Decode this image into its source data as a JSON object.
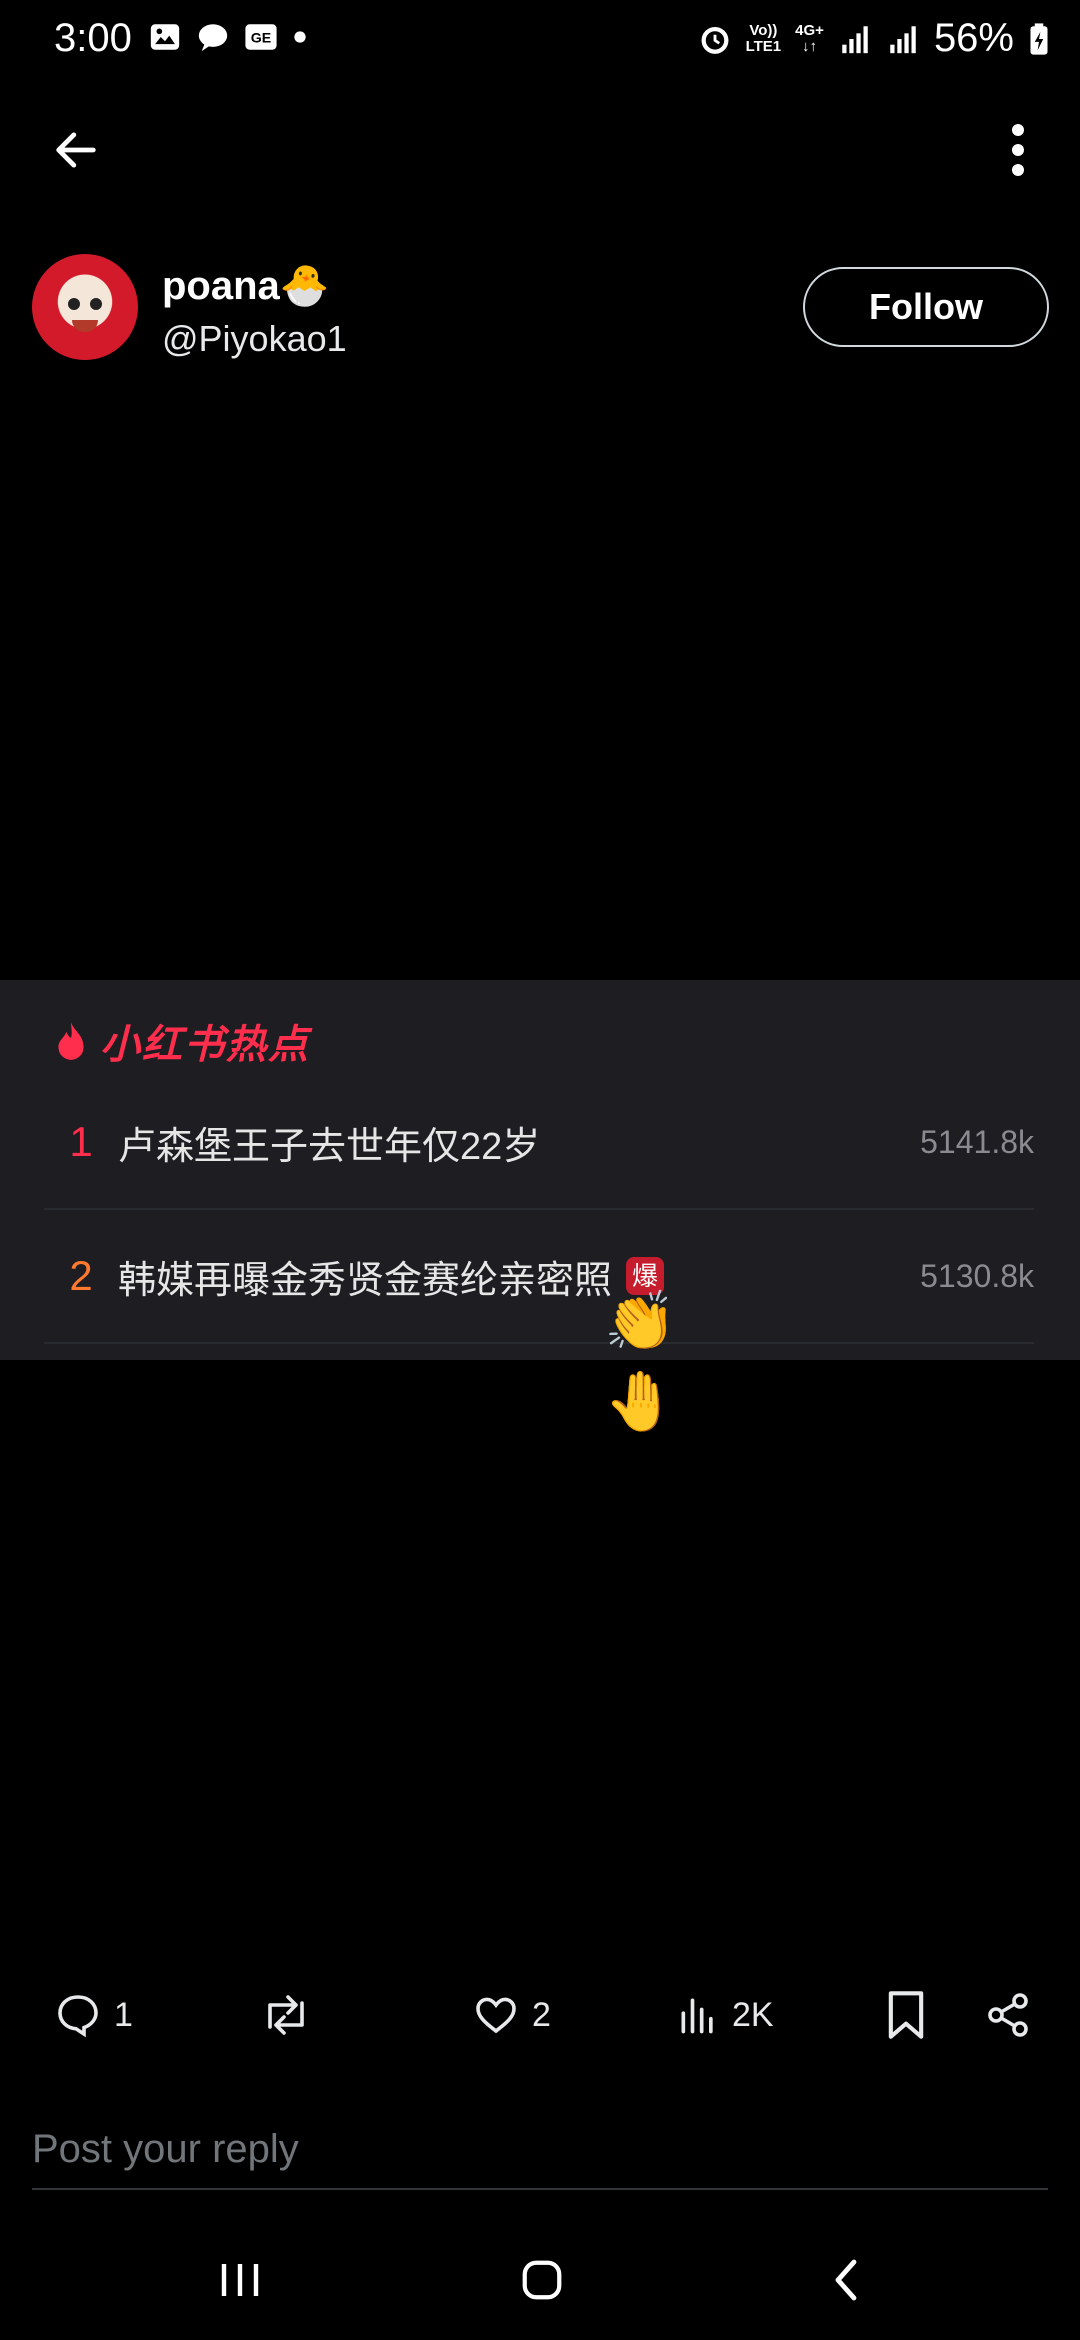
{
  "status_bar": {
    "time": "3:00",
    "left_icons": [
      "image-icon",
      "chat-bubble-icon",
      "ge-badge-icon",
      "dot-icon"
    ],
    "right_icons": [
      "alarm-icon",
      "volte-icon",
      "4g-icon",
      "signal-icon",
      "signal-icon"
    ],
    "volte_label_top": "Vo))",
    "volte_label_bottom": "LTE1",
    "network_label": "4G+",
    "battery": "56%"
  },
  "header": {
    "back_icon": "arrow-left-icon",
    "more_icon": "more-vertical-icon"
  },
  "author": {
    "display_name": "poana🐣",
    "handle": "@Piyokao1",
    "follow_label": "Follow"
  },
  "media": {
    "title": "小红书热点",
    "title_icon": "flame-icon",
    "trends": [
      {
        "rank": "1",
        "rank_color": "#ff2e4d",
        "title": "卢森堡王子去世年仅22岁",
        "count": "5141.8k",
        "badge": ""
      },
      {
        "rank": "2",
        "rank_color": "#ff7a2e",
        "title": "韩媒再曝金秀贤金赛纶亲密照",
        "count": "5130.8k",
        "badge": "爆"
      }
    ],
    "overlay_emoji": "👏🤚"
  },
  "actions": {
    "reply_count": "1",
    "repost_count": "",
    "like_count": "2",
    "views_count": "2K"
  },
  "reply": {
    "placeholder": "Post your reply"
  },
  "colors": {
    "background": "#000000",
    "card_bg": "#1d1d22",
    "accent_red": "#ff2e4d"
  }
}
